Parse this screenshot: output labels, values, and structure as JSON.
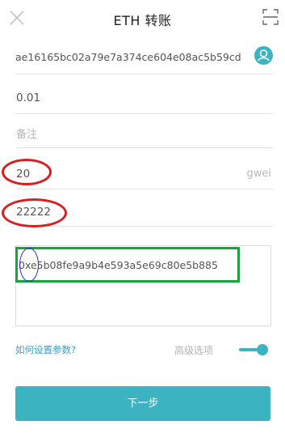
{
  "header": {
    "title": "ETH 转账",
    "close_icon": "close-icon",
    "scan_icon": "scan-icon"
  },
  "form": {
    "address": "ae16165bc02a79e7a374ce604e08ac5b59cd",
    "amount": "0.01",
    "memo_placeholder": "备注",
    "gas_price": "20",
    "gas_price_unit": "gwei",
    "gas_limit": "22222",
    "data": "0xe5b08fe9a9b4e593a5e69c80e5b885"
  },
  "footer": {
    "help_link": "如何设置参数?",
    "advanced_label": "高级选项",
    "advanced_enabled": true,
    "next_button": "下一步"
  },
  "colors": {
    "accent": "#3cb3c0",
    "link": "#3a9fc5",
    "annotation_red": "#d81e1e",
    "annotation_green": "#1aa33a",
    "annotation_blue": "#2a2ad0"
  }
}
